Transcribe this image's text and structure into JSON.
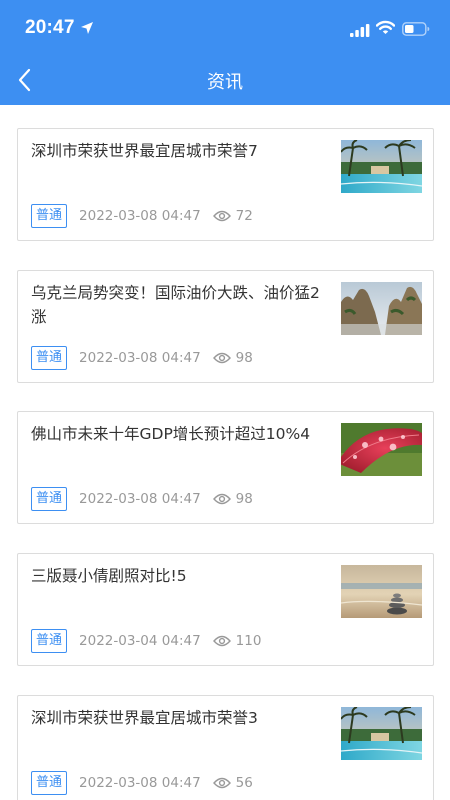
{
  "status_bar": {
    "time": "20:47",
    "icons": [
      "location-arrow-icon",
      "signal-icon",
      "wifi-icon",
      "battery-icon"
    ]
  },
  "header": {
    "title": "资讯",
    "back_icon": "chevron-left-icon"
  },
  "colors": {
    "primary": "#3d8ff2",
    "text": "#333333",
    "muted": "#999999",
    "border": "#dcdcdc"
  },
  "articles": [
    {
      "title": "深圳市荣获世界最宜居城市荣誉7",
      "tag": "普通",
      "date": "2022-03-08 04:47",
      "views": "72",
      "thumb": "resort-pool-palm-trees"
    },
    {
      "title": "乌克兰局势突变！国际油价大跌、油价猛2涨",
      "tag": "普通",
      "date": "2022-03-08 04:47",
      "views": "98",
      "thumb": "mountain-rocks-mist"
    },
    {
      "title": "佛山市未来十年GDP增长预计超过10%4",
      "tag": "普通",
      "date": "2022-03-08 04:47",
      "views": "98",
      "thumb": "red-leaf-water-drops"
    },
    {
      "title": "三版聂小倩剧照对比!5",
      "tag": "普通",
      "date": "2022-03-04 04:47",
      "views": "110",
      "thumb": "stacked-stones-beach"
    },
    {
      "title": "深圳市荣获世界最宜居城市荣誉3",
      "tag": "普通",
      "date": "2022-03-08 04:47",
      "views": "56",
      "thumb": "resort-pool-palm-trees"
    }
  ]
}
